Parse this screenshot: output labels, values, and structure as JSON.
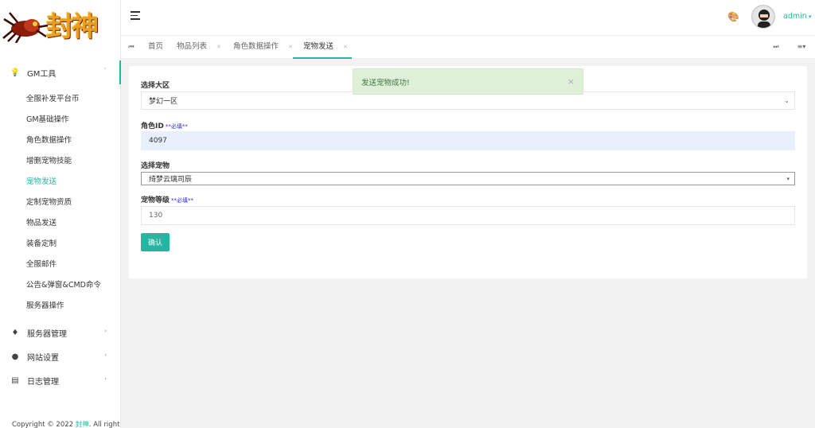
{
  "logo": {
    "text": "封神"
  },
  "sidebar": {
    "groups": [
      {
        "label": "GM工具",
        "icon": "lightbulb-icon"
      },
      {
        "label": "服务器管理",
        "icon": "diamond-icon"
      },
      {
        "label": "网站设置",
        "icon": "globe-icon"
      },
      {
        "label": "日志管理",
        "icon": "message-icon"
      }
    ],
    "items": [
      {
        "label": "全服补发平台币"
      },
      {
        "label": "GM基础操作"
      },
      {
        "label": "角色数据操作"
      },
      {
        "label": "增删宠物技能"
      },
      {
        "label": "宠物发送"
      },
      {
        "label": "定制宠物资质"
      },
      {
        "label": "物品发送"
      },
      {
        "label": "装备定制"
      },
      {
        "label": "全服邮件"
      },
      {
        "label": "公告&弹窗&CMD命令"
      },
      {
        "label": "服务器操作"
      }
    ]
  },
  "footer": {
    "prefix": "Copyright © 2022 ",
    "brand": "封神",
    "suffix": ". All right"
  },
  "header": {
    "user": "admin"
  },
  "tabs": [
    {
      "label": "首页"
    },
    {
      "label": "物品列表"
    },
    {
      "label": "角色数据操作"
    },
    {
      "label": "宠物发送"
    }
  ],
  "form": {
    "region_label": "选择大区",
    "region_value": "梦幻一区",
    "role_id_label": "角色ID",
    "required_mark": "**必填**",
    "role_id_value": "4097",
    "pet_label": "选择宠物",
    "pet_value": "绮梦云璃司辰",
    "pet_level_label": "宠物等级",
    "pet_level_value": "130",
    "confirm_label": "确认"
  },
  "toast": {
    "message": "发送宠物成功!"
  },
  "colors": {
    "accent": "#26b5a1",
    "success_bg": "#dff0d8",
    "success_text": "#3c763d",
    "required": "#2929d8"
  }
}
